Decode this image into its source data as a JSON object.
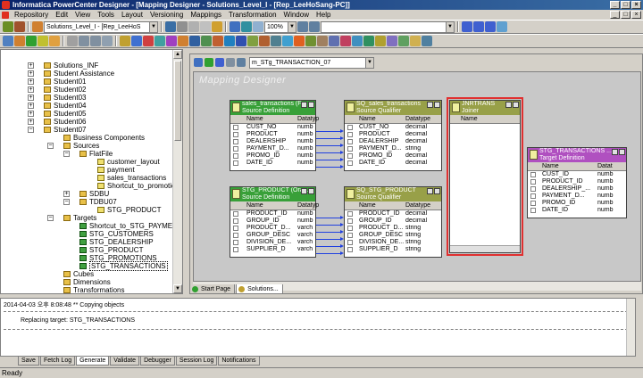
{
  "window": {
    "title": "Informatica PowerCenter Designer - [Mapping Designer - Solutions_Level_I - [Rep_LeeHoSang-PC]]"
  },
  "menu": [
    "Repository",
    "Edit",
    "View",
    "Tools",
    "Layout",
    "Versioning",
    "Mappings",
    "Transformation",
    "Window",
    "Help"
  ],
  "toolbar": {
    "folder_combo": "Solutions_Level_I - [Rep_LeeHoS",
    "zoom_combo": "100%"
  },
  "workspace_toolbar": {
    "mapping_combo": "m_STg_TRANSACTION_07"
  },
  "navigator": {
    "items": [
      {
        "label": "Solutions_INF"
      },
      {
        "label": "Student Assistance"
      },
      {
        "label": "Student01"
      },
      {
        "label": "Student02"
      },
      {
        "label": "Student03"
      },
      {
        "label": "Student04"
      },
      {
        "label": "Student05"
      },
      {
        "label": "Student06"
      },
      {
        "label": "Student07"
      },
      {
        "label": "Business Components"
      },
      {
        "label": "Sources"
      },
      {
        "label": "FlatFile"
      },
      {
        "label": "customer_layout"
      },
      {
        "label": "payment"
      },
      {
        "label": "sales_transactions"
      },
      {
        "label": "Shortcut_to_promotions"
      },
      {
        "label": "SDBU"
      },
      {
        "label": "TDBU07"
      },
      {
        "label": "STG_PRODUCT"
      },
      {
        "label": "Targets"
      },
      {
        "label": "Shortcut_to_STG_PAYMENT"
      },
      {
        "label": "STG_CUSTOMERS"
      },
      {
        "label": "STG_DEALERSHIP"
      },
      {
        "label": "STG_PRODUCT"
      },
      {
        "label": "STG_PROMOTIONS"
      },
      {
        "label": "STG_TRANSACTIONS"
      },
      {
        "label": "Cubes"
      },
      {
        "label": "Dimensions"
      },
      {
        "label": "Transformations"
      }
    ]
  },
  "canvas": {
    "title": "Mapping Designer",
    "boxes": {
      "src_sales": {
        "title": "sales_transactions (F...",
        "subtitle": "Source Definition",
        "col_name": "Name",
        "col_type": "Datatyp",
        "rows": [
          {
            "name": "CUST_NO",
            "type": "numb"
          },
          {
            "name": "PRODUCT",
            "type": "numb"
          },
          {
            "name": "DEALERSHIP",
            "type": "numb"
          },
          {
            "name": "PAYMENT_D...",
            "type": "numb"
          },
          {
            "name": "PROMO_ID",
            "type": "numb"
          },
          {
            "name": "DATE_ID",
            "type": "numb"
          }
        ]
      },
      "sq_sales": {
        "title": "SQ_sales_transactions",
        "subtitle": "Source Qualifier",
        "col_name": "Name",
        "col_type": "Datatype",
        "rows": [
          {
            "name": "CUST_NO",
            "type": "decimal"
          },
          {
            "name": "PRODUCT",
            "type": "decimal"
          },
          {
            "name": "DEALERSHIP",
            "type": "decimal"
          },
          {
            "name": "PAYMENT_D...",
            "type": "string"
          },
          {
            "name": "PROMO_ID",
            "type": "decimal"
          },
          {
            "name": "DATE_ID",
            "type": "decimal"
          }
        ]
      },
      "src_product": {
        "title": "STG_PRODUCT (Orac...",
        "subtitle": "Source Definition",
        "col_name": "Name",
        "col_type": "Datatyp",
        "rows": [
          {
            "name": "PRODUCT_ID",
            "type": "numb"
          },
          {
            "name": "GROUP_ID",
            "type": "numb"
          },
          {
            "name": "PRODUCT_D...",
            "type": "varch"
          },
          {
            "name": "GROUP_DESC",
            "type": "varch"
          },
          {
            "name": "DIVISION_DE...",
            "type": "varch"
          },
          {
            "name": "SUPPLIER_D",
            "type": "varch"
          }
        ]
      },
      "sq_product": {
        "title": "SQ_STG_PRODUCT",
        "subtitle": "Source Qualifier",
        "col_name": "Name",
        "col_type": "Datatype",
        "rows": [
          {
            "name": "PRODUCT_ID",
            "type": "decimal"
          },
          {
            "name": "GROUP_ID",
            "type": "decimal"
          },
          {
            "name": "PRODUCT_D...",
            "type": "string"
          },
          {
            "name": "GROUP_DESC",
            "type": "string"
          },
          {
            "name": "DIVISION_DE...",
            "type": "string"
          },
          {
            "name": "SUPPLIER_D",
            "type": "string"
          }
        ]
      },
      "joiner": {
        "title": "JNRTRANS",
        "subtitle": "Joiner",
        "col_name": "Name"
      },
      "target": {
        "title": "STG_TRANSACTIONS ...",
        "subtitle": "Target Definition",
        "col_name": "Name",
        "col_type": "Datat",
        "rows": [
          {
            "name": "CUST_ID",
            "type": "numb"
          },
          {
            "name": "PRODUCT_ID",
            "type": "numb"
          },
          {
            "name": "DEALERSHIP_...",
            "type": "numb"
          },
          {
            "name": "PAYMENT_D...",
            "type": "numb"
          },
          {
            "name": "PROMO_ID",
            "type": "numb"
          },
          {
            "name": "DATE_ID",
            "type": "numb"
          }
        ]
      }
    }
  },
  "doc_tabs": [
    "Start Page",
    "Solutions..."
  ],
  "output": {
    "line1": "2014-04-03 오후 8:08:48 ** Copying objects",
    "line2": "Replacing target: STG_TRANSACTIONS"
  },
  "output_tabs": [
    "Save",
    "Fetch Log",
    "Generate",
    "Validate",
    "Debugger",
    "Session Log",
    "Notifications"
  ],
  "status": "Ready"
}
